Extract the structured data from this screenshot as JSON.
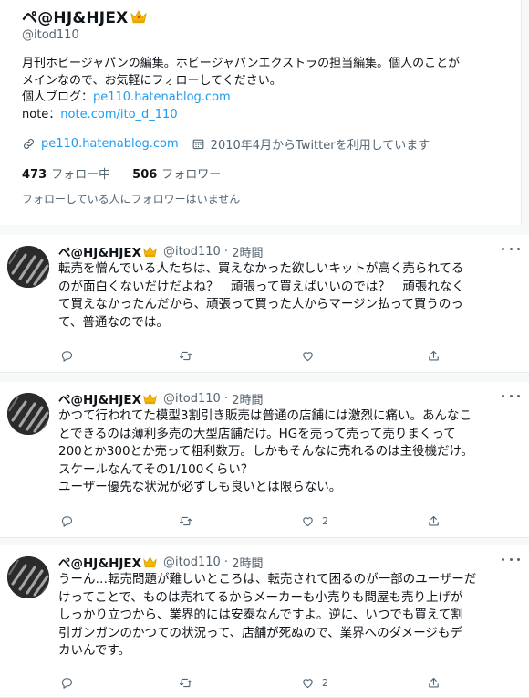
{
  "profile": {
    "name": "ペ@HJ&HJEX",
    "handle": "@itod110",
    "bio": {
      "line1": "月刊ホビージャパンの編集。ホビージャパンエクストラの担当編集。個人のことが",
      "line2": "メインなので、お気軽にフォローしてください。",
      "blog_label": "個人ブログ：",
      "blog_link": "pe110.hatenablog.com",
      "note_label": "note：",
      "note_link": "note.com/ito_d_110"
    },
    "meta": {
      "website": "pe110.hatenablog.com",
      "joined": "2010年4月からTwitterを利用しています"
    },
    "following_count": "473",
    "following_label": "フォロー中",
    "followers_count": "506",
    "followers_label": "フォロワー",
    "mutual_note": "フォローしている人にフォロワーはいません"
  },
  "tweets": [
    {
      "author": "ペ@HJ&HJEX",
      "handle": "@itod110",
      "time": "2時間",
      "lines": [
        "転売を憎んでいる人たちは、買えなかった欲しいキットが高く売られてる",
        "のが面白くないだけだよね？　頑張って買えばいいのでは？　頑張れなく",
        "て買えなかったんだから、頑張って買った人からマージン払って買うのっ",
        "て、普通なのでは。"
      ],
      "likes": ""
    },
    {
      "author": "ペ@HJ&HJEX",
      "handle": "@itod110",
      "time": "2時間",
      "lines": [
        "かつて行われてた模型3割引き販売は普通の店舗には激烈に痛い。あんなこ",
        "とできるのは薄利多売の大型店舗だけ。HGを売って売って売りまくって",
        "200とか300とか売って粗利数万。しかもそんなに売れるのは主役機だけ。",
        "スケールなんてその1/100くらい？",
        "ユーザー優先な状況が必ずしも良いとは限らない。"
      ],
      "likes": "2"
    },
    {
      "author": "ペ@HJ&HJEX",
      "handle": "@itod110",
      "time": "2時間",
      "lines": [
        "うーん…転売問題が難しいところは、転売されて困るのが一部のユーザーだ",
        "けってことで、ものは売れてるからメーカーも小売りも問屋も売り上げが",
        "しっかり立つから、業界的には安泰なんですよ。逆に、いつでも買えて割",
        "引ガンガンのかつての状況って、店舗が死ぬので、業界へのダメージもデ",
        "カいんです。"
      ],
      "likes": "2"
    }
  ],
  "icons": [
    "crown-icon",
    "link-icon",
    "calendar-icon",
    "more-icon",
    "reply-icon",
    "retweet-icon",
    "like-icon",
    "share-icon"
  ],
  "colors": {
    "accent": "#1d9bf0",
    "text": "#0f1419",
    "muted": "#536471",
    "background": "#f7f9f9"
  }
}
